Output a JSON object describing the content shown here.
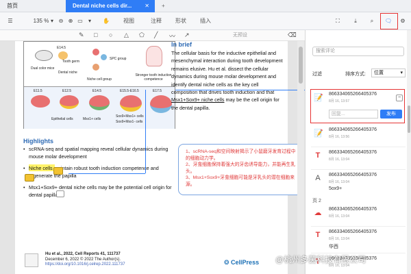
{
  "tabs": {
    "home": "首页",
    "document": "Dental niche cells dir...",
    "close": "✕",
    "add": "+"
  },
  "toolbar": {
    "zoom": "135 %",
    "menus": [
      "视图",
      "注释",
      "形状",
      "插入"
    ]
  },
  "annotation_bar": {
    "placeholder": "无预设"
  },
  "document": {
    "in_brief_heading": "In brief",
    "in_brief_text_1": "The cellular basis for the inductive epithelial and mesenchymal interaction during tooth development remains elusive. Hu et al. dissect the cellular dynamics during mouse molar development and identify dental niche cells as the key cell composition that drives tooth induction and that ",
    "in_brief_highlight": "Msx1+Sox9+ niche cells",
    "in_brief_text_2": " may be the cell origin for the dental papilla.",
    "highlights_heading": "Highlights",
    "highlights": [
      "scRNA-seq and spatial mapping reveal cellular dynamics during mouse molar development",
      "Niche cells maintain robust tooth induction competence and regenerate the papilla",
      "Msx1+Sox9+ dental niche cells may be the potential cell origin for dental papilla"
    ],
    "graphic_labels": {
      "mice": "Dual color mice",
      "e145": "E14.5",
      "tooth_germ": "Tooth germ",
      "dental_niche": "Dental niche",
      "spc": "SPC group",
      "niche_group": "Niche cell group",
      "stronger": "Stronger tooth induction competence",
      "e11": "E11.5",
      "e12": "E12.5",
      "e14": "E14.5",
      "e15": "E15.5-E16.5",
      "e17": "E17.5",
      "epithelial": "Epithelial cells",
      "msx1": "Msx1+ cells",
      "sox9": "Sox9+Msx1+ cells",
      "sox9b": "Sox9+Msx1- cells"
    },
    "balloon": [
      "1、scRNA-seq和空间映射揭示了小鼠磨牙发育过程中的细胞动力学。",
      "2、牙龛细胞保持着强大的牙齿诱导能力，并能再生乳头。",
      "3、Msx1+Sox9+牙龛细胞可能是牙乳头的潜在细胞来源。"
    ],
    "footer": {
      "citation": "Hu et al., 2022, Cell Reports 41, 111737",
      "date": "December 6, 2022 © 2022 The Author(s).",
      "doi": "https://doi.org/10.1016/j.celrep.2022.111737",
      "brand": "CellPress"
    }
  },
  "panel": {
    "search_placeholder": "搜索评论",
    "filter": "过滤",
    "sort_label": "排序方式:",
    "sort_value": "位置",
    "reply_placeholder": "回复...",
    "reply_button": "发布",
    "page2_label": "页 2",
    "comments": [
      {
        "icon": "📝",
        "user": "866334065266405376",
        "time": "8月 16, 13:57",
        "body": ""
      },
      {
        "icon": "📝",
        "user": "866334065266405376",
        "time": "8月 16, 13:56",
        "body": ""
      },
      {
        "icon": "T",
        "user": "866334065266405376",
        "time": "8月 16, 13:04",
        "body": ""
      },
      {
        "icon": "A",
        "user": "866334065266405376",
        "time": "8月 16, 13:04",
        "body": "5ox9+"
      },
      {
        "icon": "☁",
        "user": "866334065266405376",
        "time": "8月 16, 13:04",
        "body": ""
      },
      {
        "icon": "T",
        "user": "866334065266405376",
        "time": "8月 16, 13:04",
        "body": "华西"
      },
      {
        "icon": "T",
        "user": "866334065266405376",
        "time": "8月 16, 13:04",
        "body": ""
      }
    ]
  },
  "watermark": "@杭州多茵科技有限公司"
}
